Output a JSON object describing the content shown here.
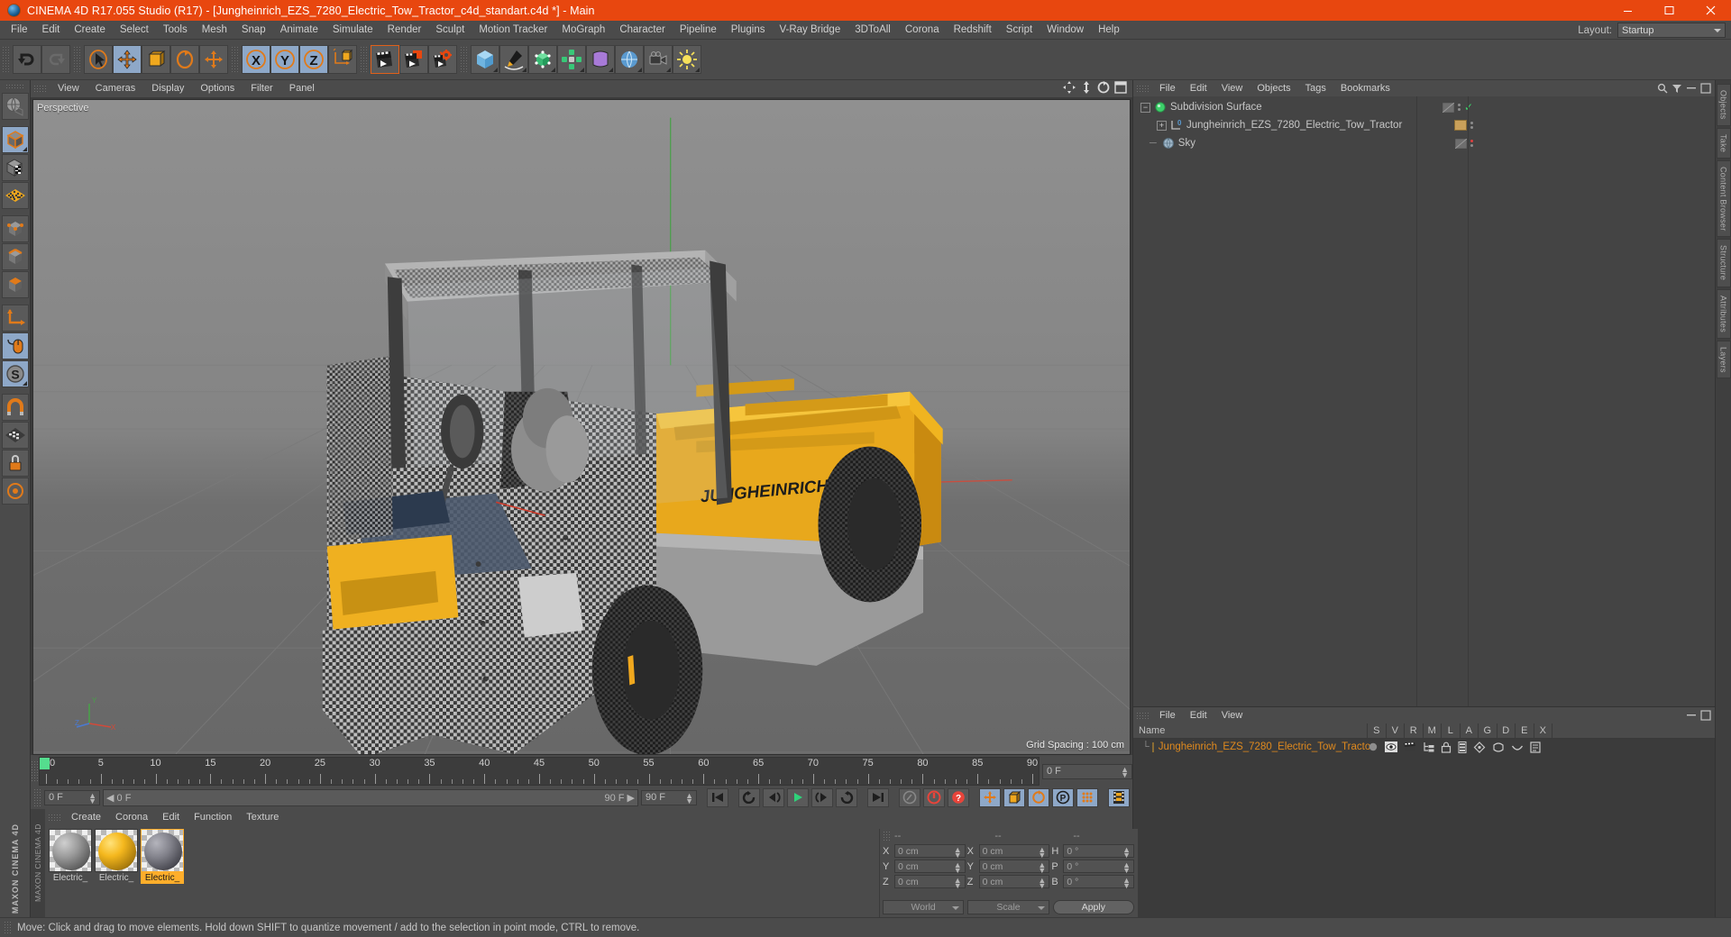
{
  "window": {
    "title": "CINEMA 4D R17.055 Studio (R17) - [Jungheinrich_EZS_7280_Electric_Tow_Tractor_c4d_standart.c4d *] - Main",
    "minimize_label": "–",
    "maximize_label": "□",
    "close_label": "✕",
    "accent_color": "#e8470f"
  },
  "menubar": {
    "items": [
      {
        "label": "File"
      },
      {
        "label": "Edit"
      },
      {
        "label": "Create"
      },
      {
        "label": "Select"
      },
      {
        "label": "Tools"
      },
      {
        "label": "Mesh"
      },
      {
        "label": "Snap"
      },
      {
        "label": "Animate"
      },
      {
        "label": "Simulate"
      },
      {
        "label": "Render"
      },
      {
        "label": "Sculpt"
      },
      {
        "label": "Motion Tracker"
      },
      {
        "label": "MoGraph"
      },
      {
        "label": "Character"
      },
      {
        "label": "Pipeline"
      },
      {
        "label": "Plugins"
      },
      {
        "label": "V-Ray Bridge"
      },
      {
        "label": "3DToAll"
      },
      {
        "label": "Corona"
      },
      {
        "label": "Redshift"
      },
      {
        "label": "Script"
      },
      {
        "label": "Window"
      },
      {
        "label": "Help"
      }
    ],
    "layout_label": "Layout:",
    "layout_value": "Startup"
  },
  "toolbar": {
    "groups": [
      {
        "buttons": [
          {
            "name": "undo-button",
            "icon": "undo-icon",
            "active": false
          },
          {
            "name": "redo-button",
            "icon": "redo-icon",
            "active": false
          }
        ]
      },
      {
        "buttons": [
          {
            "name": "live-selection-tool",
            "icon": "cursor-select-icon",
            "active": false
          },
          {
            "name": "move-tool",
            "icon": "move-icon",
            "active": true
          },
          {
            "name": "scale-tool",
            "icon": "scale-icon",
            "active": false
          },
          {
            "name": "rotate-tool",
            "icon": "rotate-icon",
            "active": false
          },
          {
            "name": "global-move-tool",
            "icon": "cross-move-icon",
            "active": false
          }
        ]
      },
      {
        "buttons": [
          {
            "name": "axis-lock-x",
            "icon": "x-axis-icon",
            "active": true
          },
          {
            "name": "axis-lock-y",
            "icon": "y-axis-icon",
            "active": true
          },
          {
            "name": "axis-lock-z",
            "icon": "z-axis-icon",
            "active": true
          },
          {
            "name": "world-object-coords",
            "icon": "world-coord-icon",
            "active": false
          }
        ]
      },
      {
        "buttons": [
          {
            "name": "render-view-button",
            "icon": "render-clapper-icon",
            "active": false
          },
          {
            "name": "render-to-picture-viewer-button",
            "icon": "render-picture-icon",
            "active": false
          },
          {
            "name": "render-settings-button",
            "icon": "render-settings-icon",
            "active": false
          }
        ]
      },
      {
        "buttons": [
          {
            "name": "add-cube-button",
            "icon": "cube-icon",
            "active": false
          },
          {
            "name": "add-spline-button",
            "icon": "pen-spline-icon",
            "active": false
          },
          {
            "name": "add-generator-button",
            "icon": "green-cube-icon",
            "active": false
          },
          {
            "name": "add-mograph-button",
            "icon": "cloner-icon",
            "active": false
          },
          {
            "name": "add-deformer-button",
            "icon": "deformer-icon",
            "active": false
          },
          {
            "name": "add-environment-button",
            "icon": "environment-icon",
            "active": false
          },
          {
            "name": "add-camera-button",
            "icon": "camera-icon",
            "active": false
          },
          {
            "name": "add-light-button",
            "icon": "light-icon",
            "active": false
          }
        ]
      }
    ]
  },
  "left_palette": {
    "buttons": [
      {
        "name": "undo-view-button",
        "icon": "globe-view-icon",
        "active": false
      },
      {
        "name": "model-mode-button",
        "icon": "model-cube-icon",
        "active": true
      },
      {
        "name": "texture-mode-button",
        "icon": "texture-checker-icon",
        "active": false
      },
      {
        "name": "uv-mode-button",
        "icon": "uv-mesh-icon",
        "active": false
      },
      {
        "name": "points-mode-button",
        "icon": "points-cube-icon",
        "active": false
      },
      {
        "name": "edges-mode-button",
        "icon": "edges-cube-icon",
        "active": false
      },
      {
        "name": "polygons-mode-button",
        "icon": "polygons-cube-icon",
        "active": false
      },
      {
        "name": "axis-mode-button",
        "icon": "axis-icon",
        "active": false
      },
      {
        "name": "viewport-solo-button",
        "icon": "mouse-icon",
        "active": true
      },
      {
        "name": "snap-button",
        "icon": "snap-s-icon",
        "active": true
      },
      {
        "name": "magnet-button",
        "icon": "magnet-icon",
        "active": false
      },
      {
        "name": "workplane-button",
        "icon": "workplane-icon",
        "active": false
      },
      {
        "name": "lock-workplane-button",
        "icon": "lock-icon",
        "active": false
      },
      {
        "name": "workplane-mode-button",
        "icon": "target-icon",
        "active": false
      }
    ],
    "brand": "MAXON CINEMA 4D"
  },
  "viewport": {
    "menu": [
      {
        "label": "View"
      },
      {
        "label": "Cameras"
      },
      {
        "label": "Display"
      },
      {
        "label": "Options"
      },
      {
        "label": "Filter"
      },
      {
        "label": "Panel"
      }
    ],
    "label": "Perspective",
    "grid_spacing": "Grid Spacing : 100 cm",
    "axis_labels": {
      "y": "Y",
      "x": "X",
      "z": "Z"
    },
    "background_top": "#8c8c8c",
    "background_bottom": "#6a6a6a"
  },
  "timeline": {
    "ticks": [
      0,
      5,
      10,
      15,
      20,
      25,
      30,
      35,
      40,
      45,
      50,
      55,
      60,
      65,
      70,
      75,
      80,
      85,
      90
    ],
    "current_frame": "0 F",
    "range_start": "0 F",
    "range_end": "90 F",
    "end_frame": "90 F",
    "playhead_frame": 0
  },
  "powerslider": {
    "current_field": "0 F",
    "start_field": "0 F",
    "end_field": "90 F",
    "max_field": "90 F",
    "transport": [
      {
        "name": "go-to-start-button",
        "icon": "skip-start-icon"
      },
      {
        "name": "play-backwards-button",
        "icon": "rewind-loop-icon"
      },
      {
        "name": "previous-frame-button",
        "icon": "prev-frame-icon"
      },
      {
        "name": "play-button",
        "icon": "play-icon"
      },
      {
        "name": "next-frame-button",
        "icon": "next-frame-icon"
      },
      {
        "name": "play-forwards-loop-button",
        "icon": "forward-loop-icon"
      },
      {
        "name": "go-to-end-button",
        "icon": "skip-end-icon"
      }
    ],
    "record_tools": [
      {
        "name": "record-active-objects-button",
        "icon": "key-icon"
      },
      {
        "name": "autokeying-button",
        "icon": "autokey-icon"
      },
      {
        "name": "keyframe-selection-button",
        "icon": "question-key-icon"
      }
    ],
    "key_toggles": [
      {
        "name": "position-key-button",
        "icon": "position-icon",
        "active": true
      },
      {
        "name": "scale-key-button",
        "icon": "scale-key-icon",
        "active": true
      },
      {
        "name": "rotation-key-button",
        "icon": "rotation-key-icon",
        "active": true
      },
      {
        "name": "parameter-key-button",
        "icon": "param-p-icon",
        "active": true
      },
      {
        "name": "point-level-animation-button",
        "icon": "pla-dots-icon",
        "active": true
      }
    ],
    "extra": [
      {
        "name": "timeline-button",
        "icon": "film-icon",
        "active": true
      }
    ]
  },
  "material_manager": {
    "side_label": "MAXON CINEMA 4D",
    "menu": [
      {
        "label": "Create"
      },
      {
        "label": "Corona"
      },
      {
        "label": "Edit"
      },
      {
        "label": "Function"
      },
      {
        "label": "Texture"
      }
    ],
    "materials": [
      {
        "name": "Electric_",
        "selected": false,
        "color_a": "#9a9a9a",
        "color_b": "#5a5a5a"
      },
      {
        "name": "Electric_",
        "selected": false,
        "color_a": "#f5b81e",
        "color_b": "#7a5a08"
      },
      {
        "name": "Electric_",
        "selected": true,
        "color_a": "#8a8a90",
        "color_b": "#3d3d44"
      }
    ]
  },
  "coordinate_manager": {
    "headers": [
      "--",
      "--",
      "--"
    ],
    "rows": [
      {
        "label_a": "X",
        "value_a": "0 cm",
        "label_b": "X",
        "value_b": "0 cm",
        "label_c": "H",
        "value_c": "0 °"
      },
      {
        "label_a": "Y",
        "value_a": "0 cm",
        "label_b": "Y",
        "value_b": "0 cm",
        "label_c": "P",
        "value_c": "0 °"
      },
      {
        "label_a": "Z",
        "value_a": "0 cm",
        "label_b": "Z",
        "value_b": "0 cm",
        "label_c": "B",
        "value_c": "0 °"
      }
    ],
    "coord_system": "World",
    "transform_mode": "Scale",
    "apply_label": "Apply"
  },
  "object_manager": {
    "menu": [
      {
        "label": "File"
      },
      {
        "label": "Edit"
      },
      {
        "label": "View"
      },
      {
        "label": "Objects"
      },
      {
        "label": "Tags"
      },
      {
        "label": "Bookmarks"
      }
    ],
    "rows": [
      {
        "name": "Subdivision Surface",
        "icon": "subdivision-surface-icon",
        "indent": 0,
        "expander": "−",
        "tag_type": "none",
        "dot_color": "#6fc06f",
        "check": true
      },
      {
        "name": "Jungheinrich_EZS_7280_Electric_Tow_Tractor",
        "icon": "null-object-icon",
        "indent": 1,
        "expander": "+",
        "tag_type": "material",
        "tag_color": "#c9a05a"
      },
      {
        "name": "Sky",
        "icon": "sky-icon",
        "indent": 0,
        "expander": "",
        "tag_type": "none",
        "dot_color": "#e04040"
      }
    ]
  },
  "attribute_manager": {
    "menu": [
      {
        "label": "File"
      },
      {
        "label": "Edit"
      },
      {
        "label": "View"
      }
    ],
    "name_header": "Name",
    "columns": [
      "S",
      "V",
      "R",
      "M",
      "L",
      "A",
      "G",
      "D",
      "E",
      "X"
    ],
    "rows": [
      {
        "name": "Jungheinrich_EZS_7280_Electric_Tow_Tractor",
        "color": "#e08a1e"
      }
    ]
  },
  "right_dock": {
    "tabs": [
      "Objects",
      "Take",
      "Content Browser",
      "Structure",
      "Attributes",
      "Layers"
    ]
  },
  "statusbar": {
    "message": "Move: Click and drag to move elements. Hold down SHIFT to quantize movement / add to the selection in point mode, CTRL to remove."
  }
}
